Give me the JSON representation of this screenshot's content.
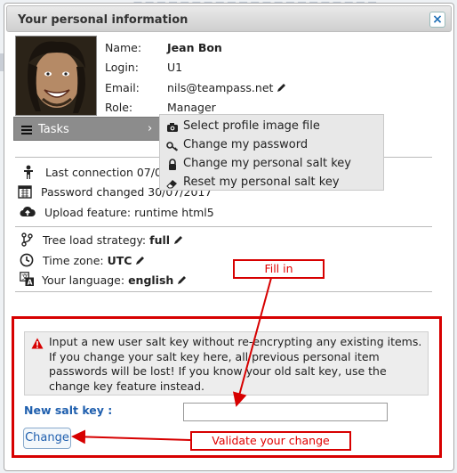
{
  "background": {
    "text": "— — — — — — — — — — — — — — — — — — — — —"
  },
  "dialog": {
    "title": "Your personal information",
    "close_icon": "×"
  },
  "profile": {
    "name_label": "Name:",
    "name_value": "Jean Bon",
    "login_label": "Login:",
    "login_value": "U1",
    "email_label": "Email:",
    "email_value": "nils@teampass.net",
    "role_label": "Role:",
    "role_value": "Manager"
  },
  "tasks": {
    "label": "Tasks",
    "chevron": "›",
    "menu": [
      {
        "icon": "camera-icon",
        "label": "Select profile image file"
      },
      {
        "icon": "key-icon",
        "label": "Change my password"
      },
      {
        "icon": "lock-icon",
        "label": "Change my personal salt key"
      },
      {
        "icon": "eraser-icon",
        "label": "Reset my personal salt key"
      }
    ]
  },
  "stats": {
    "last_connection": "Last connection 07/04",
    "password_changed": "Password changed 30/07/2017",
    "upload_feature": "Upload feature: runtime html5"
  },
  "settings": {
    "tree_label": "Tree load strategy:",
    "tree_value": "full",
    "timezone_label": "Time zone:",
    "timezone_value": "UTC",
    "language_label": "Your language:",
    "language_value": "english"
  },
  "salt": {
    "notice": "Input a new user salt key without re-encrypting any existing items. If you change your salt key here, all previous personal item passwords will be lost! If you know your old salt key, use the change key feature instead.",
    "label": "New salt key :",
    "input_value": "",
    "button": "Change"
  },
  "annotations": {
    "fill_in": "Fill in",
    "validate": "Validate your change"
  },
  "colors": {
    "annotation_red": "#d70000",
    "link_blue": "#1f5fae",
    "tasks_gray": "#8c8c8c"
  }
}
